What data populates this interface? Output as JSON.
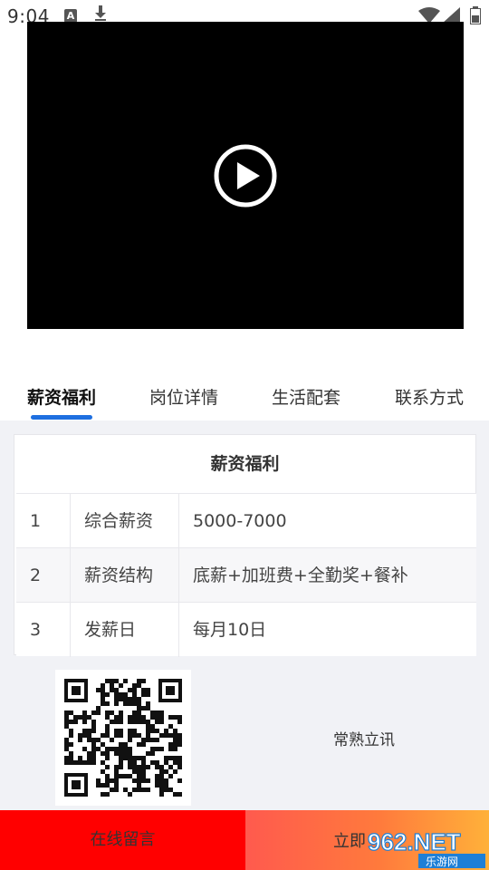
{
  "status_bar": {
    "time": "9:04",
    "notification_letter": "A",
    "icons": [
      "text-notification-icon",
      "download-icon",
      "wifi-icon",
      "signal-icon",
      "battery-icon"
    ]
  },
  "video": {
    "play_icon": "play-circle-icon"
  },
  "tabs": [
    {
      "label": "薪资福利",
      "active": true
    },
    {
      "label": "岗位详情",
      "active": false
    },
    {
      "label": "生活配套",
      "active": false
    },
    {
      "label": "联系方式",
      "active": false
    }
  ],
  "salary_card": {
    "title": "薪资福利",
    "rows": [
      {
        "index": "1",
        "name": "综合薪资",
        "value": "5000-7000"
      },
      {
        "index": "2",
        "name": "薪资结构",
        "value": "底薪+加班费+全勤奖+餐补"
      },
      {
        "index": "3",
        "name": "发薪日",
        "value": "每月10日"
      }
    ]
  },
  "qr": {
    "icon": "qr-code-icon"
  },
  "company_name": "常熟立讯",
  "bottom": {
    "left_label": "在线留言",
    "right_label": "立即"
  },
  "watermark": {
    "main": "962.NET",
    "sub": "乐游网"
  },
  "colors": {
    "accent": "#1e6fe0",
    "bottom_left": "#ff0000",
    "bottom_right_start": "#ff5a4e",
    "bottom_right_end": "#ffb13a",
    "content_bg": "#f1f2f6"
  }
}
